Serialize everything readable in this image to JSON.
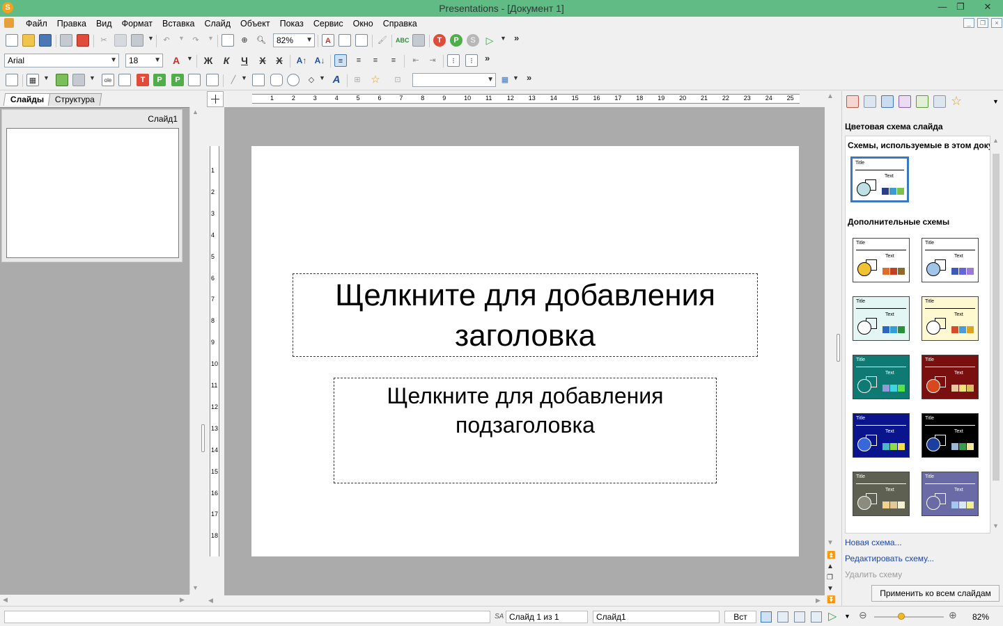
{
  "window": {
    "title": "Presentations - [Документ 1]",
    "app_letter": "S",
    "minimize": "—",
    "restore": "❐",
    "close": "✕"
  },
  "menu": {
    "items": [
      "Файл",
      "Правка",
      "Вид",
      "Формат",
      "Вставка",
      "Слайд",
      "Объект",
      "Показ",
      "Сервис",
      "Окно",
      "Справка"
    ]
  },
  "toolbar": {
    "zoom": "82%",
    "font_name": "Arial",
    "font_size": "18",
    "more": "»",
    "bold": "Ж",
    "italic": "К",
    "underline": "Ч",
    "strike": "Х",
    "strike2": "Х",
    "grow_font": "A↑",
    "shrink_font": "A↓",
    "style_combo": ""
  },
  "left_pane": {
    "tabs": [
      "Слайды",
      "Структура"
    ],
    "slides": [
      {
        "label": "Слайд1"
      }
    ]
  },
  "ruler": {
    "h": [
      "1",
      "2",
      "3",
      "4",
      "5",
      "6",
      "7",
      "8",
      "9",
      "10",
      "11",
      "12",
      "13",
      "14",
      "15",
      "16",
      "17",
      "18",
      "19",
      "20",
      "21",
      "22",
      "23",
      "24",
      "25"
    ],
    "v": [
      "1",
      "2",
      "3",
      "4",
      "5",
      "6",
      "7",
      "8",
      "9",
      "10",
      "11",
      "12",
      "13",
      "14",
      "15",
      "16",
      "17",
      "18"
    ]
  },
  "slide": {
    "title_placeholder_line1": "Щелкните для добавления",
    "title_placeholder_line2": "заголовка",
    "subtitle_placeholder_line1": "Щелкните для добавления",
    "subtitle_placeholder_line2": "подзаголовка"
  },
  "right_pane": {
    "heading": "Цветовая схема слайда",
    "used_section": "Схемы, используемые в этом доку",
    "more_section": "Дополнительные схемы",
    "scheme_title": "Title",
    "scheme_text": "Text",
    "schemes_used": [
      {
        "bg": "#ffffff",
        "fg": "#000000",
        "shape": "#bfe0e6",
        "bars": [
          "#2b3f8c",
          "#3c9bd0",
          "#7cc24a"
        ]
      }
    ],
    "schemes_more": [
      {
        "bg": "#ffffff",
        "fg": "#000000",
        "shape": "#f1c232",
        "bars": [
          "#e06b2b",
          "#c1411f",
          "#8e6a2a"
        ]
      },
      {
        "bg": "#ffffff",
        "fg": "#000000",
        "shape": "#9fc5e8",
        "bars": [
          "#3d5ab8",
          "#6466d6",
          "#9b7ad6"
        ]
      },
      {
        "bg": "#e4f6f4",
        "fg": "#000000",
        "shape": "#ffffff",
        "bars": [
          "#2b66c2",
          "#2f9fd6",
          "#2a8f3a"
        ]
      },
      {
        "bg": "#fff9d2",
        "fg": "#000000",
        "shape": "#ffffff",
        "bars": [
          "#d84a2a",
          "#4a9bd8",
          "#e0a020"
        ]
      },
      {
        "bg": "#0f7a74",
        "fg": "#ffffff",
        "shape": "#0f7a74",
        "bars": [
          "#8f9bd6",
          "#3cd6e6",
          "#55e24a"
        ]
      },
      {
        "bg": "#7a0f0f",
        "fg": "#ffffff",
        "shape": "#d8471e",
        "bars": [
          "#e8c9a0",
          "#f2e27a",
          "#d8c060"
        ]
      },
      {
        "bg": "#0a148c",
        "fg": "#ffffff",
        "shape": "#3767d8",
        "bars": [
          "#4ab6c9",
          "#8fdc4a",
          "#f2e04a"
        ]
      },
      {
        "bg": "#000000",
        "fg": "#ffffff",
        "shape": "#1c3e9c",
        "bars": [
          "#9cb8d6",
          "#3e9c52",
          "#f2e8a0"
        ]
      },
      {
        "bg": "#5e6152",
        "fg": "#ffffff",
        "shape": "#8c8c7e",
        "bars": [
          "#f2d28c",
          "#e2c89a",
          "#f5f2d0"
        ]
      },
      {
        "bg": "#6a6aa6",
        "fg": "#ffffff",
        "shape": "#6a6aa6",
        "bars": [
          "#a0c8f0",
          "#d8e8f8",
          "#f2f090"
        ]
      }
    ],
    "link_new": "Новая схема...",
    "link_edit": "Редактировать схему...",
    "link_delete": "Удалить схему",
    "apply_all": "Применить ко всем слайдам"
  },
  "status": {
    "left_field": "",
    "slide_counter": "Слайд 1 из 1",
    "slide_name": "Слайд1",
    "insert_mode": "Вст",
    "zoom": "82%",
    "zoom_fraction": 0.5
  }
}
